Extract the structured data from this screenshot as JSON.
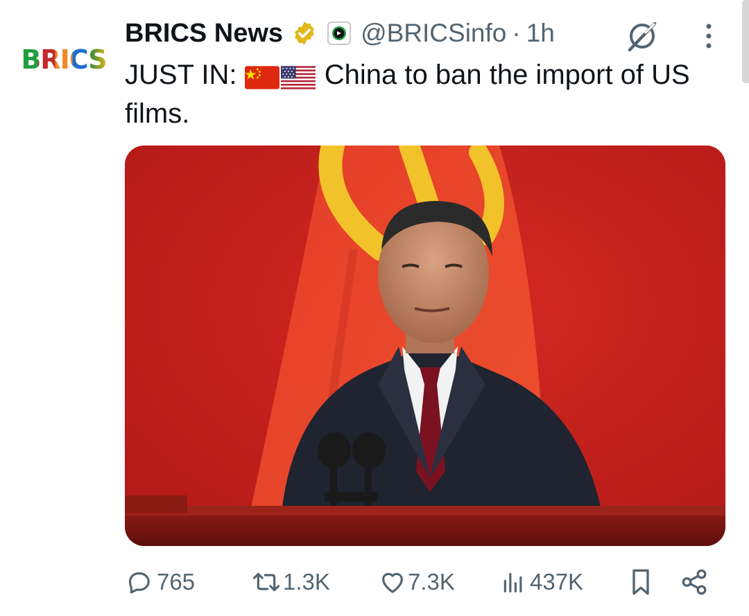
{
  "author": {
    "avatar_text": "BRICS",
    "display_name": "BRICS News",
    "handle": "@BRICSinfo",
    "separator": "·",
    "time": "1h",
    "verified_badge_icon": "verified-gold-badge-icon",
    "affiliation_icon": "affiliate-badge-icon"
  },
  "tweet": {
    "text_prefix": "JUST IN:",
    "flags": [
      "china-flag-icon",
      "usa-flag-icon"
    ],
    "text_body": "China to ban the import of US films."
  },
  "media": {
    "type": "photo"
  },
  "actions": {
    "replies": "765",
    "reposts": "1.3K",
    "likes": "7.3K",
    "views": "437K"
  },
  "colors": {
    "text": "#0f1419",
    "muted": "#536471",
    "gold_badge": "#e2b719",
    "media_background": "#c8201d"
  }
}
